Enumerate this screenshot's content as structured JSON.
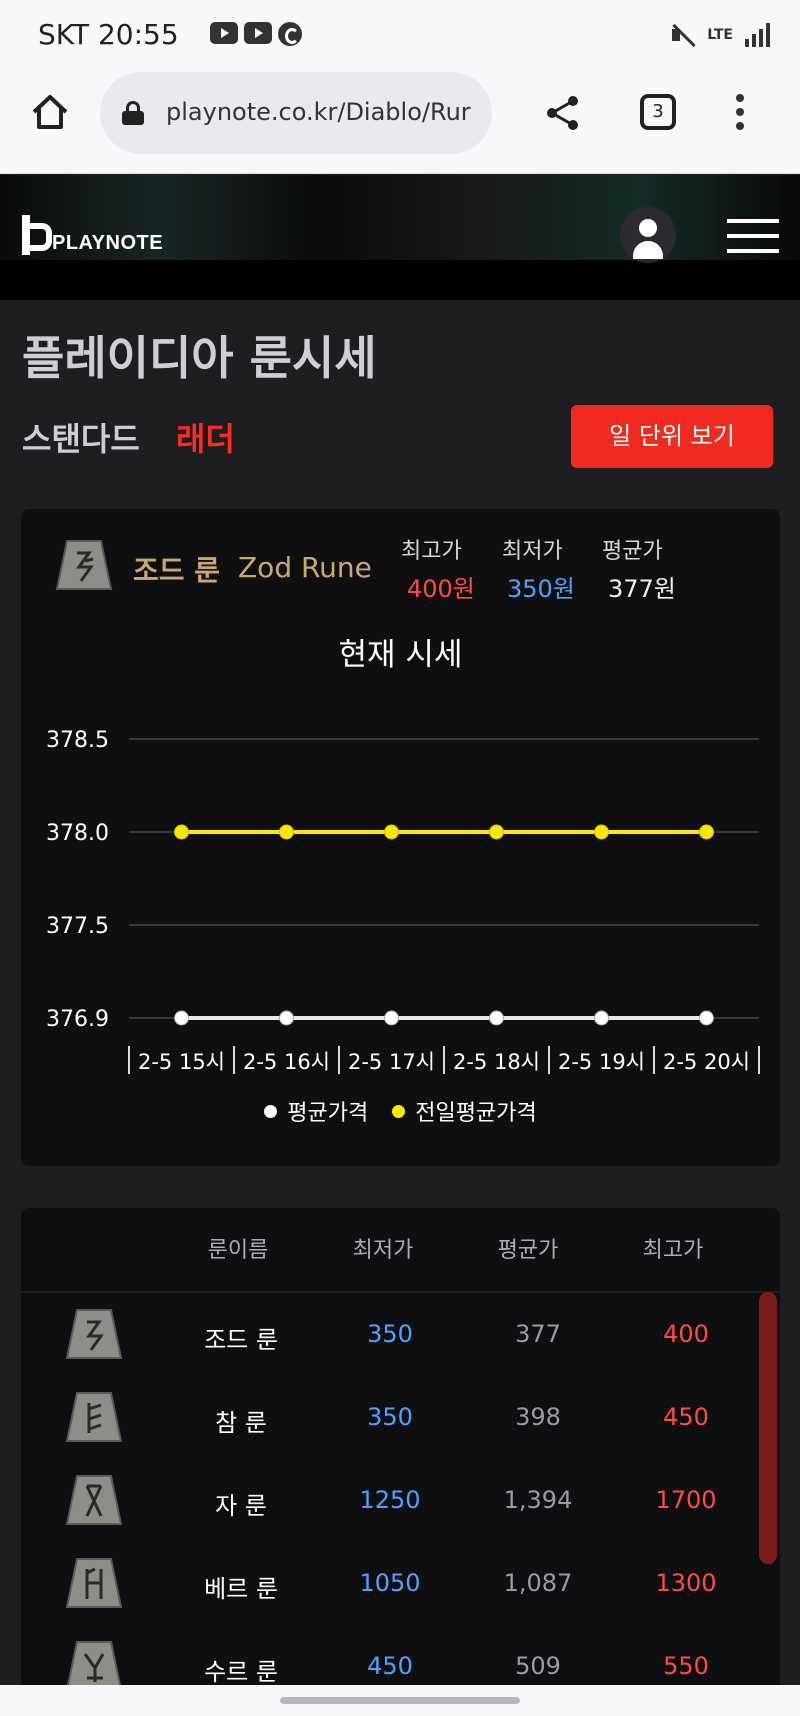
{
  "status_bar": {
    "carrier": "SKT",
    "time": "20:55",
    "network": "LTE",
    "icons": [
      "youtube-icon",
      "youtube-icon",
      "sync-icon",
      "mute-icon",
      "lte-icon",
      "signal-icon"
    ]
  },
  "browser": {
    "url": "playnote.co.kr/Diablo/Rur",
    "tab_count": "3",
    "icons": [
      "home-icon",
      "lock-icon",
      "share-icon",
      "tabs-icon",
      "kebab-menu-icon"
    ]
  },
  "site": {
    "logo_text": "PLAYNOTE",
    "icons": [
      "user-icon",
      "hamburger-menu-icon"
    ]
  },
  "page": {
    "title": "플레이디아 룬시세",
    "mode_standard": "스탠다드",
    "mode_ladder": "래더",
    "day_view_button": "일 단위 보기",
    "accent_color": "#f12a1f"
  },
  "summary": {
    "rune_name_ko": "조드 룬",
    "rune_name_en": "Zod Rune",
    "max_label": "최고가",
    "max_value": "400원",
    "min_label": "최저가",
    "min_value": "350원",
    "avg_label": "평균가",
    "avg_value": "377원"
  },
  "chart_data": {
    "type": "line",
    "title": "현재 시세",
    "categories": [
      "2-5 15시",
      "2-5 16시",
      "2-5 17시",
      "2-5 18시",
      "2-5 19시",
      "2-5 20시"
    ],
    "y_ticks": [
      "378.5",
      "378.0",
      "377.5",
      "376.9"
    ],
    "y_tick_values": [
      378.5,
      378.0,
      377.5,
      377.0
    ],
    "series": [
      {
        "name": "평균가격",
        "color": "#ffffff",
        "values": [
          377,
          377,
          377,
          377,
          377,
          377
        ]
      },
      {
        "name": "전일평균가격",
        "color": "#ffe600",
        "values": [
          378,
          378,
          378,
          378,
          378,
          378
        ]
      }
    ],
    "legend_position": "bottom",
    "grid": true
  },
  "table": {
    "headers": {
      "name": "룬이름",
      "min": "최저가",
      "avg": "평균가",
      "max": "최고가"
    },
    "rows": [
      {
        "name": "조드 룬",
        "min": "350",
        "avg": "377",
        "max": "400"
      },
      {
        "name": "참 룬",
        "min": "350",
        "avg": "398",
        "max": "450"
      },
      {
        "name": "자 룬",
        "min": "1250",
        "avg": "1,394",
        "max": "1700"
      },
      {
        "name": "베르 룬",
        "min": "1050",
        "avg": "1,087",
        "max": "1300"
      },
      {
        "name": "수르 룬",
        "min": "450",
        "avg": "509",
        "max": "550"
      }
    ]
  }
}
